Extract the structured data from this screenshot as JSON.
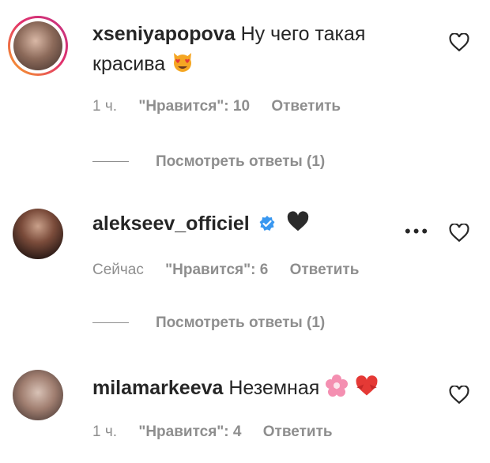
{
  "comments": [
    {
      "username": "xseniyapopova",
      "text": "Ну чего такая красива",
      "text_line1": "Ну чего такая",
      "text_line2": "красива",
      "emoji": "smiling-cat-heart-eyes",
      "time": "1 ч.",
      "likes_label": "\"Нравится\": 10",
      "reply_label": "Ответить",
      "view_replies": "Посмотреть ответы (1)"
    },
    {
      "username": "alekseev_officiel",
      "verified": true,
      "text": "",
      "emoji": "black-heart",
      "time": "Сейчас",
      "likes_label": "\"Нравится\": 6",
      "reply_label": "Ответить",
      "more_label": "•••",
      "view_replies": "Посмотреть ответы (1)"
    },
    {
      "username": "milamarkeeva",
      "text": "Неземная",
      "emoji": [
        "cherry-blossom",
        "heart-with-ribbon"
      ],
      "time": "1 ч.",
      "likes_label": "\"Нравится\": 4",
      "reply_label": "Ответить"
    }
  ],
  "colors": {
    "text": "#262626",
    "secondary": "#8e8e8e",
    "verified": "#3897f0",
    "story_ring_start": "#f9a825",
    "story_ring_end": "#c13584"
  }
}
